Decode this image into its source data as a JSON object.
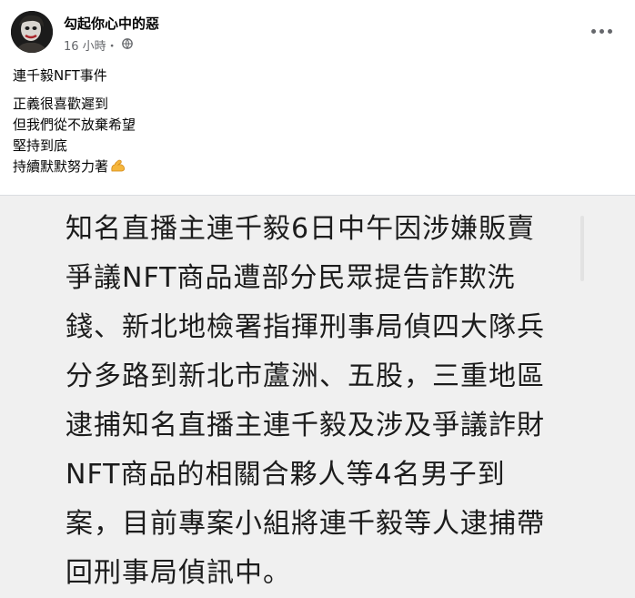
{
  "post": {
    "author_name": "勾起你心中的惡",
    "timestamp": "16 小時・",
    "audience_icon": "globe-icon",
    "more_icon": "more-options-icon"
  },
  "caption": {
    "title": "連千毅NFT事件",
    "lines": [
      "正義很喜歡遲到",
      "但我們從不放棄希望",
      "堅持到底",
      "持續默默努力著"
    ],
    "emoji": "flexed-biceps-icon"
  },
  "image_text": {
    "lines": [
      "知名直播主連千毅6日中午因涉嫌販賣",
      "爭議NFT商品遭部分民眾提告詐欺洗",
      "錢、新北地檢署指揮刑事局偵四大隊兵",
      "分多路到新北市蘆洲、五股，三重地區",
      "逮捕知名直播主連千毅及涉及爭議詐財",
      "NFT商品的相關合夥人等4名男子到",
      "案，目前專案小組將連千毅等人逮捕帶",
      "回刑事局偵訊中。"
    ]
  }
}
